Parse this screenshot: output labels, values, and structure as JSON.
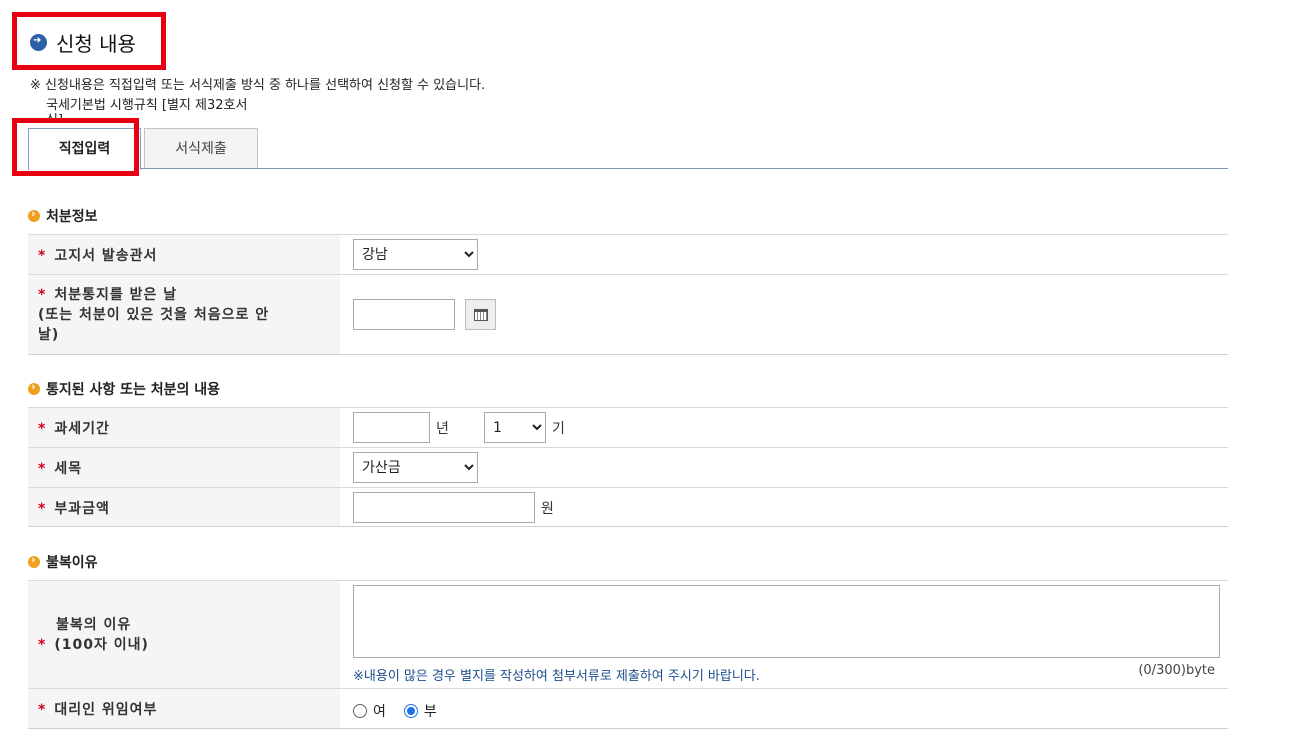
{
  "header": {
    "title": "신청 내용",
    "notice": "※ 신청내용은 직접입력 또는 서식제출 방식 중 하나를 선택하여 신청할 수 있습니다.",
    "notice_sub1": "국세기본법 시행규칙 [별지 제32호서",
    "notice_sub2": "식]"
  },
  "tabs": [
    {
      "label": "직접입력",
      "active": true
    },
    {
      "label": "서식제출",
      "active": false
    }
  ],
  "section1": {
    "heading": "처분정보",
    "office_label": "고지서 발송관서",
    "office_value": "강남",
    "notice_date_label_1": "처분통지를 받은 날",
    "notice_date_label_2": "(또는 처분이 있은 것을 처음으로 안",
    "notice_date_label_3": "날)",
    "notice_date_value": ""
  },
  "section2": {
    "heading": "통지된 사항 또는 처분의 내용",
    "period_label": "과세기간",
    "year_value": "",
    "year_unit": "년",
    "term_value": "1",
    "term_unit": "기",
    "tax_item_label": "세목",
    "tax_item_value": "가산금",
    "amount_label": "부과금액",
    "amount_value": "",
    "amount_unit": "원"
  },
  "section3": {
    "heading": "불복이유",
    "reason_label_1": "불복의 이유",
    "reason_label_2": "(100자 이내)",
    "reason_value": "",
    "help_text": "※내용이 많은 경우 별지를 작성하여 첨부서류로 제출하여 주시기 바랍니다.",
    "counter": "(0/300)byte",
    "proxy_label": "대리인 위임여부",
    "proxy_yes": "여",
    "proxy_no": "부",
    "proxy_selected": "부"
  },
  "required_mark": "*",
  "colors": {
    "required": "#d0021b",
    "highlight_box": "#e60012",
    "accent": "#f0a020",
    "tab_line": "#7f95b8"
  }
}
